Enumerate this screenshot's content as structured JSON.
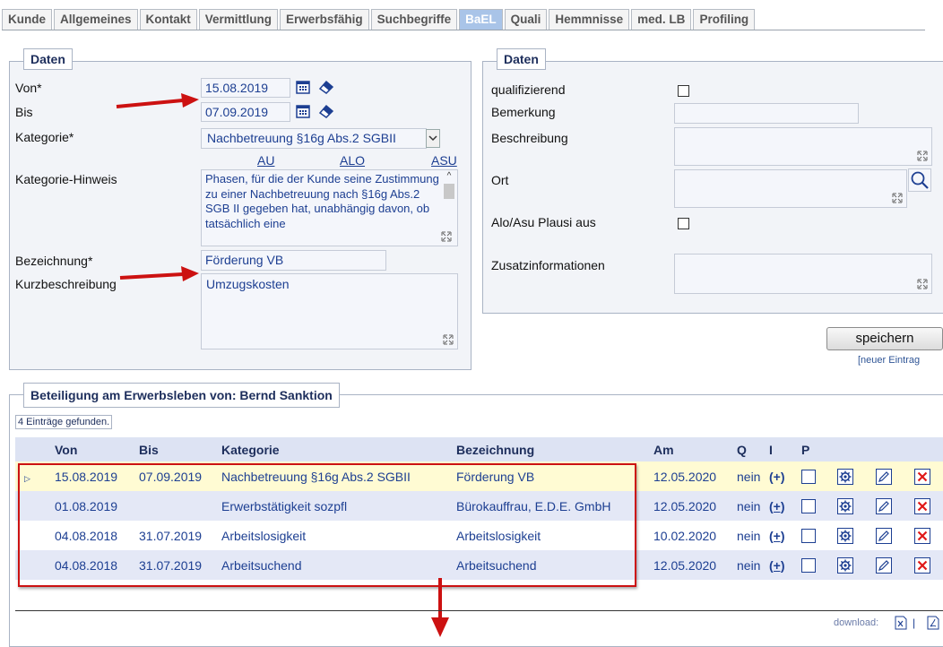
{
  "tabs": [
    "Kunde",
    "Allgemeines",
    "Kontakt",
    "Vermittlung",
    "Erwerbsfähig",
    "Suchbegriffe",
    "BaEL",
    "Quali",
    "Hemmnisse",
    "med. LB",
    "Profiling"
  ],
  "active_tab": "BaEL",
  "left_panel": {
    "legend": "Daten",
    "von_label": "Von*",
    "von_value": "15.08.2019",
    "bis_label": "Bis",
    "bis_value": "07.09.2019",
    "kategorie_label": "Kategorie*",
    "kategorie_value": "Nachbetreuung §16g Abs.2 SGBII",
    "hint_links": [
      "AU",
      "ALO",
      "ASU"
    ],
    "kategorie_hinweis_label": "Kategorie-Hinweis",
    "kategorie_hinweis_text": "Phasen, für die der Kunde seine Zustimmung zu einer Nachbetreuung nach §16g Abs.2 SGB II gegeben hat, unabhängig davon, ob tatsächlich eine",
    "bezeichnung_label": "Bezeichnung*",
    "bezeichnung_value": "Förderung VB",
    "kurzbeschreibung_label": "Kurzbeschreibung",
    "kurzbeschreibung_value": "Umzugskosten"
  },
  "right_panel": {
    "legend": "Daten",
    "qualifizierend_label": "qualifizierend",
    "bemerkung_label": "Bemerkung",
    "beschreibung_label": "Beschreibung",
    "ort_label": "Ort",
    "plausi_label": "Alo/Asu Plausi aus",
    "zusatz_label": "Zusatzinformationen"
  },
  "save_button": "speichern",
  "new_entry_link": "[neuer Eintrag",
  "bottom_panel": {
    "legend": "Beteiligung am Erwerbsleben von: Bernd Sanktion",
    "count_text": "4 Einträge gefunden.",
    "columns": [
      "Von",
      "Bis",
      "Kategorie",
      "Bezeichnung",
      "Am",
      "Q",
      "I",
      "P"
    ],
    "rows": [
      {
        "von": "15.08.2019",
        "bis": "07.09.2019",
        "kategorie": "Nachbetreuung §16g Abs.2 SGBII",
        "bezeichnung": "Förderung VB",
        "am": "12.05.2020",
        "q": "nein",
        "i": "(+)"
      },
      {
        "von": "01.08.2019",
        "bis": "",
        "kategorie": "Erwerbstätigkeit sozpfl",
        "bezeichnung": "Bürokauffrau, E.D.E. GmbH",
        "am": "12.05.2020",
        "q": "nein",
        "i": "(+)"
      },
      {
        "von": "04.08.2018",
        "bis": "31.07.2019",
        "kategorie": "Arbeitslosigkeit",
        "bezeichnung": "Arbeitslosigkeit",
        "am": "10.02.2020",
        "q": "nein",
        "i": "(+)"
      },
      {
        "von": "04.08.2018",
        "bis": "31.07.2019",
        "kategorie": "Arbeitsuchend",
        "bezeichnung": "Arbeitsuchend",
        "am": "12.05.2020",
        "q": "nein",
        "i": "(+)"
      }
    ]
  },
  "download_label": "download:",
  "colors": {
    "arrow": "#cc1111",
    "tab_active": "#a9c4e8",
    "link": "#1d3f92",
    "highlight_row": "#fffbd3",
    "delete": "#e01818"
  },
  "icons": [
    "calendar-icon",
    "eraser-icon",
    "resize-icon",
    "search-icon",
    "row-expand-icon",
    "gear-icon",
    "edit-icon",
    "delete-icon",
    "excel-icon",
    "pdf-icon"
  ]
}
